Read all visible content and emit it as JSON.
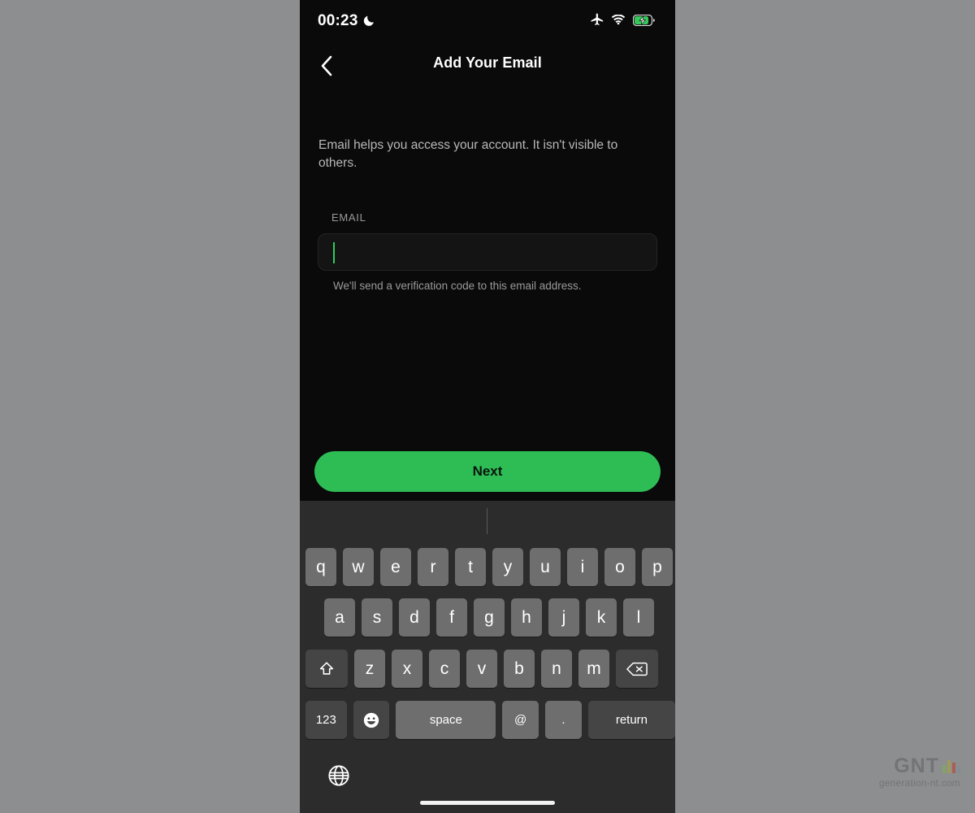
{
  "background_color": "#8c8e90",
  "phone": {
    "screen_background": "#0a0a0a",
    "status_bar": {
      "time": "00:23",
      "moon_icon": "crescent-moon-icon",
      "airplane_icon": "airplane-mode-icon",
      "wifi_icon": "wifi-icon",
      "battery_icon": "battery-charging-icon",
      "battery_level_percent": 75,
      "battery_color": "#34c759"
    },
    "nav_bar": {
      "back_icon": "chevron-left-icon",
      "title": "Add Your Email"
    },
    "content": {
      "intro_text": "Email helps you access your account. It isn't visible to others.",
      "field_label": "EMAIL",
      "input_value": "",
      "input_placeholder": "",
      "caret_color": "#2ecc5f",
      "helper_text": "We'll send a verification code to this email address."
    },
    "primary_button": {
      "label": "Next",
      "color": "#2ebd55",
      "text_color": "#08140c"
    },
    "keyboard": {
      "background": "#2c2c2c",
      "key_color": "#6e6e6e",
      "special_key_color": "#454545",
      "predictive_bar_suggestions": [],
      "rows": [
        {
          "keys": [
            {
              "label": "q",
              "name": "key-q",
              "type": "letter"
            },
            {
              "label": "w",
              "name": "key-w",
              "type": "letter"
            },
            {
              "label": "e",
              "name": "key-e",
              "type": "letter"
            },
            {
              "label": "r",
              "name": "key-r",
              "type": "letter"
            },
            {
              "label": "t",
              "name": "key-t",
              "type": "letter"
            },
            {
              "label": "y",
              "name": "key-y",
              "type": "letter"
            },
            {
              "label": "u",
              "name": "key-u",
              "type": "letter"
            },
            {
              "label": "i",
              "name": "key-i",
              "type": "letter"
            },
            {
              "label": "o",
              "name": "key-o",
              "type": "letter"
            },
            {
              "label": "p",
              "name": "key-p",
              "type": "letter"
            }
          ]
        },
        {
          "keys": [
            {
              "label": "a",
              "name": "key-a",
              "type": "letter"
            },
            {
              "label": "s",
              "name": "key-s",
              "type": "letter"
            },
            {
              "label": "d",
              "name": "key-d",
              "type": "letter"
            },
            {
              "label": "f",
              "name": "key-f",
              "type": "letter"
            },
            {
              "label": "g",
              "name": "key-g",
              "type": "letter"
            },
            {
              "label": "h",
              "name": "key-h",
              "type": "letter"
            },
            {
              "label": "j",
              "name": "key-j",
              "type": "letter"
            },
            {
              "label": "k",
              "name": "key-k",
              "type": "letter"
            },
            {
              "label": "l",
              "name": "key-l",
              "type": "letter"
            }
          ]
        },
        {
          "keys": [
            {
              "label": "",
              "name": "shift-key",
              "type": "shift-icon"
            },
            {
              "label": "z",
              "name": "key-z",
              "type": "letter"
            },
            {
              "label": "x",
              "name": "key-x",
              "type": "letter"
            },
            {
              "label": "c",
              "name": "key-c",
              "type": "letter"
            },
            {
              "label": "v",
              "name": "key-v",
              "type": "letter"
            },
            {
              "label": "b",
              "name": "key-b",
              "type": "letter"
            },
            {
              "label": "n",
              "name": "key-n",
              "type": "letter"
            },
            {
              "label": "m",
              "name": "key-m",
              "type": "letter"
            },
            {
              "label": "",
              "name": "backspace-key",
              "type": "backspace-icon"
            }
          ]
        },
        {
          "keys": [
            {
              "label": "123",
              "name": "numbers-key",
              "type": "label"
            },
            {
              "label": "",
              "name": "emoji-key",
              "type": "emoji-icon"
            },
            {
              "label": "space",
              "name": "space-key",
              "type": "label"
            },
            {
              "label": "@",
              "name": "at-key",
              "type": "label"
            },
            {
              "label": ".",
              "name": "period-key",
              "type": "label"
            },
            {
              "label": "return",
              "name": "return-key",
              "type": "label"
            }
          ]
        }
      ],
      "globe_icon": "globe-icon",
      "home_indicator": "home-indicator"
    }
  },
  "watermark": {
    "word": "GNT",
    "domain": "generation-nt.com",
    "bar_colors": [
      "#7ab648",
      "#b5a72a",
      "#c0392b",
      "#7f8c99"
    ]
  }
}
